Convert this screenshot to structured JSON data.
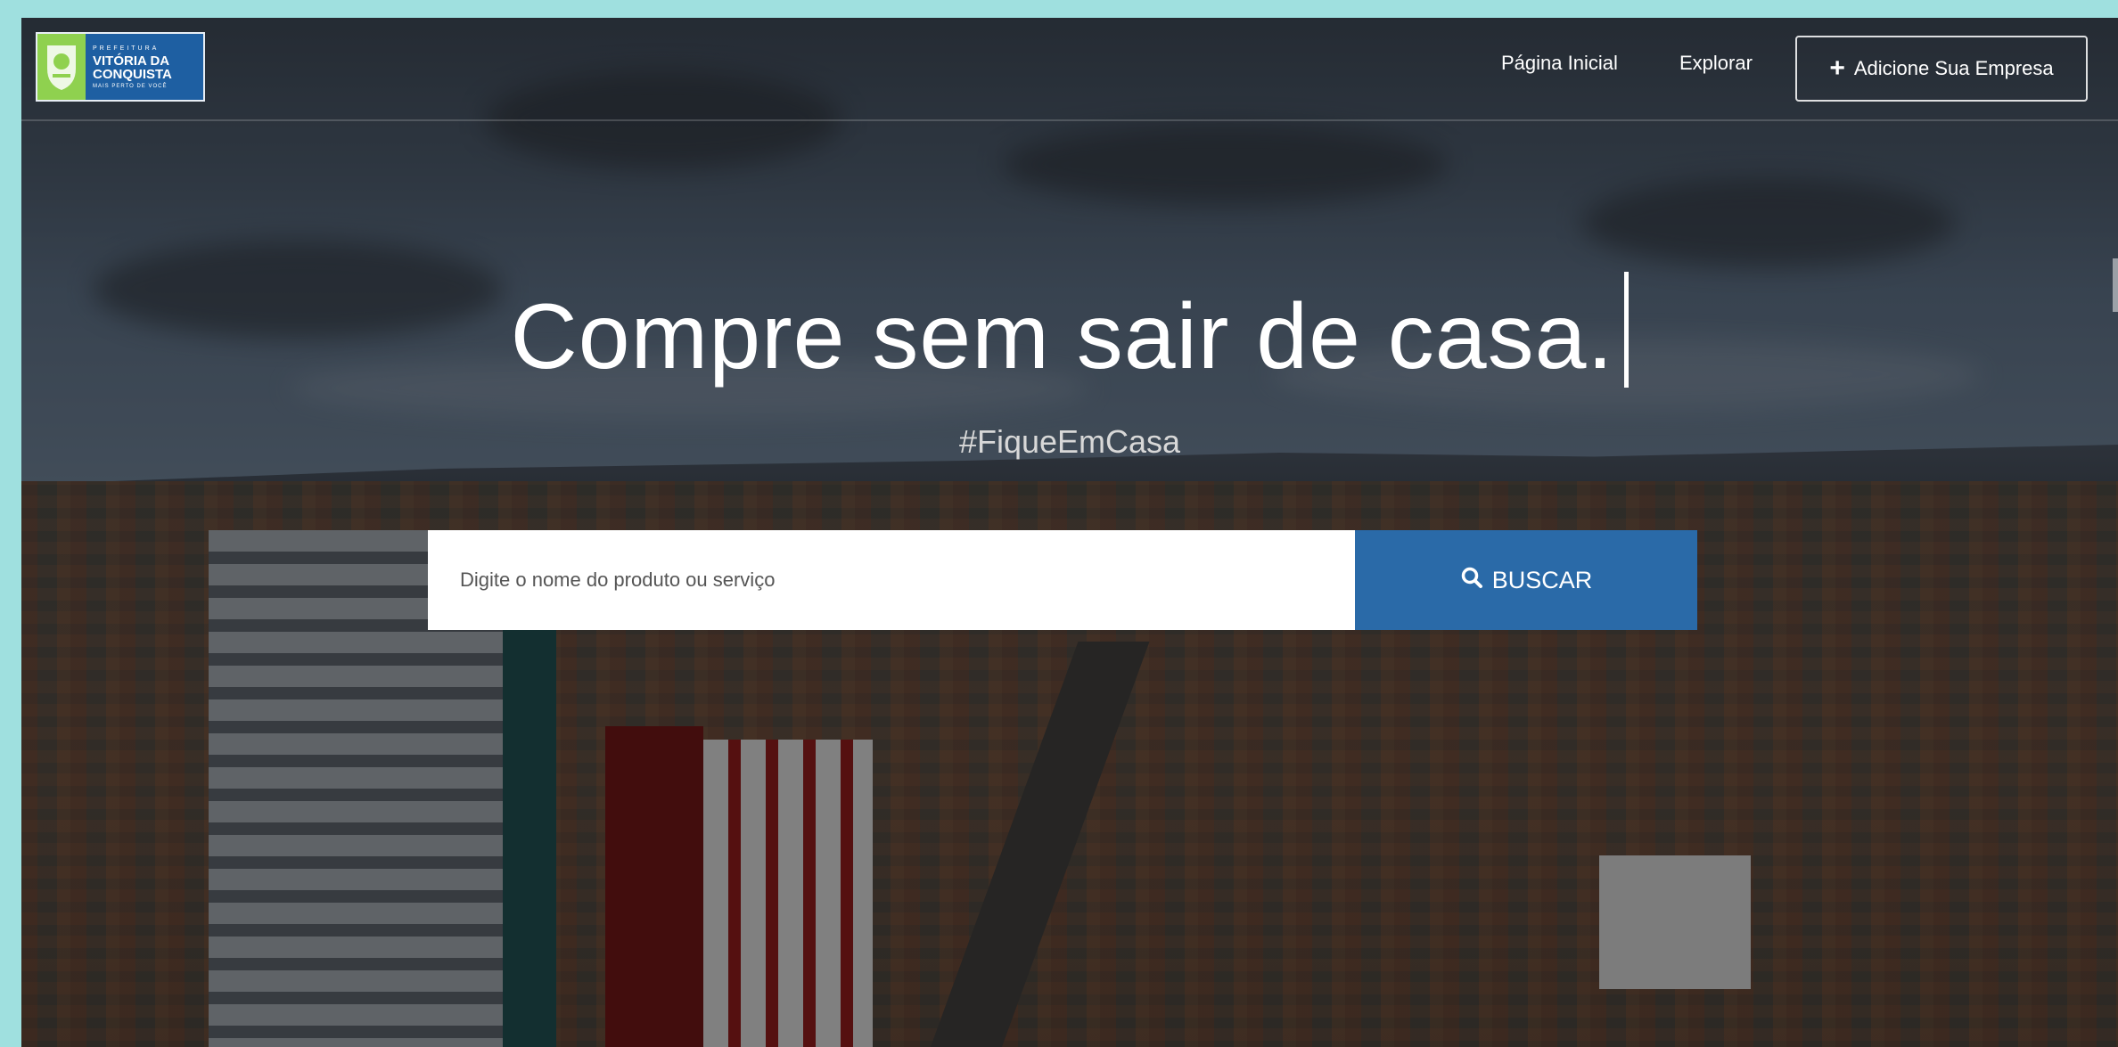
{
  "brand": {
    "small_text": "PREFEITURA",
    "line1": "VITÓRIA DA",
    "line2": "CONQUISTA",
    "tagline": "MAIS PERTO DE VOCÊ"
  },
  "nav": {
    "home": "Página Inicial",
    "explore": "Explorar",
    "add_business": "Adicione Sua Empresa",
    "add_icon": "plus-icon"
  },
  "hero": {
    "headline": "Compre sem sair de casa.",
    "hashtag": "#FiqueEmCasa"
  },
  "search": {
    "placeholder": "Digite o nome do produto ou serviço",
    "value": "",
    "button_label": "BUSCAR",
    "button_icon": "search-icon"
  },
  "colors": {
    "primary": "#2a6aa8",
    "logo_green": "#8fd14f",
    "page_border": "#9fe0df"
  }
}
